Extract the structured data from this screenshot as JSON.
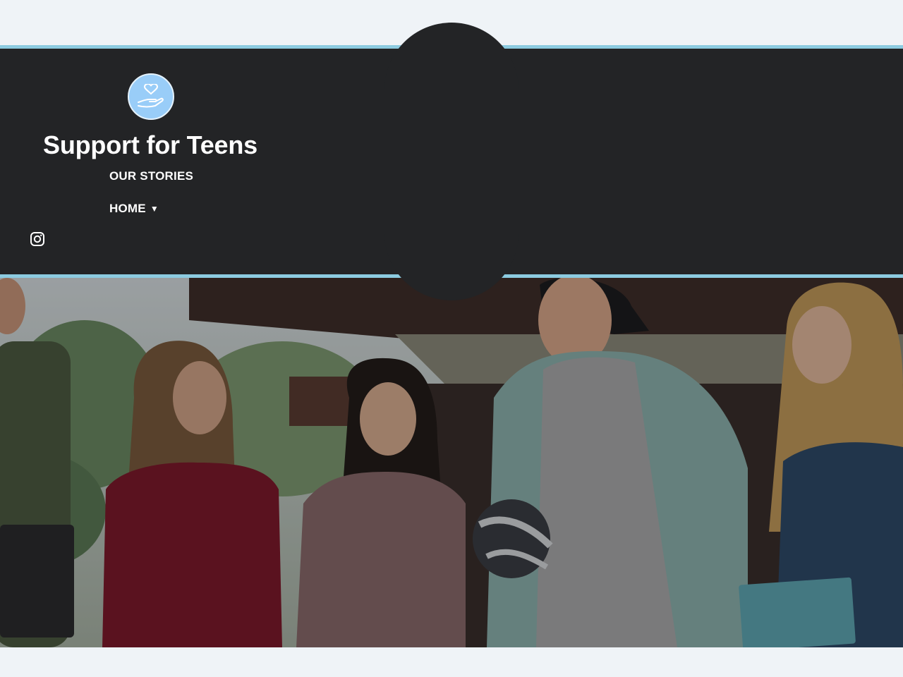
{
  "site": {
    "title": "Support for Teens",
    "logo_icon": "heart-in-hand-icon",
    "logo_color": "#99cdf8",
    "accent_color": "#8ccbe0",
    "header_color": "#232426"
  },
  "nav": {
    "items": [
      {
        "label": "OUR STORIES"
      },
      {
        "label": "HOME",
        "caret": "▼"
      }
    ]
  },
  "social": {
    "icon": "instagram-icon"
  },
  "hero": {
    "image_icon": "group-of-teens-photo"
  }
}
